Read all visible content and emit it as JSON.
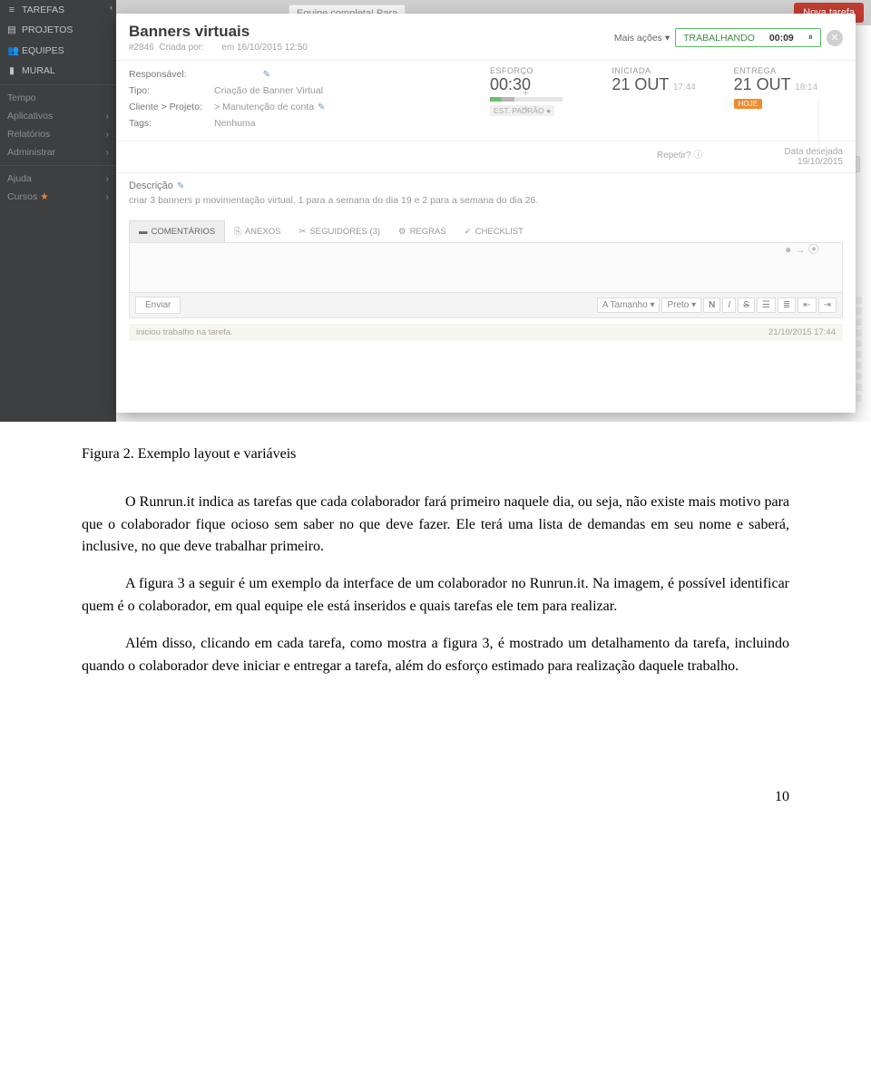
{
  "sidebar": {
    "items": [
      "TAREFAS",
      "PROJETOS",
      "EQUIPES",
      "MURAL"
    ],
    "sub": [
      "Tempo",
      "Aplicativos",
      "Relatórios",
      "Administrar"
    ],
    "help": "Ajuda",
    "courses": "Cursos"
  },
  "bg": {
    "equip": "Equipe completa! Para",
    "newtask": "Nova tarefa"
  },
  "modal": {
    "title": "Banners virtuais",
    "meta_id": "#2846",
    "meta_created_label": "Criada por:",
    "meta_date": "em 16/10/2015 12:50",
    "more": "Mais ações ▾",
    "status_label": "TRABALHANDO",
    "status_time": "00:09",
    "pause": "⏸",
    "fields": {
      "resp_label": "Responsável:",
      "tipo_label": "Tipo:",
      "tipo_val": "Criação de Banner Virtual",
      "cp_label": "Cliente > Projeto:",
      "cp_val": "> Manutenção de conta",
      "tags_label": "Tags:",
      "tags_val": "Nenhuma"
    },
    "cards": {
      "effort_label": "ESFORÇO",
      "effort_val": "00:30",
      "est_label": "EST. PADRÃO",
      "start_label": "INICIADA",
      "start_date": "21 OUT",
      "start_time": "17:44",
      "due_label": "ENTREGA",
      "due_date": "21 OUT",
      "due_time": "18:14",
      "hoje": "HOJE"
    },
    "repeat_label": "Repetir?",
    "desired_label": "Data desejada",
    "desired_val": "19/10/2015",
    "desc_title": "Descrição",
    "desc_text": "criar 3 banners p movimentação virtual. 1 para a semana do dia 19 e 2 para a semana do dia 26.",
    "tabs": [
      "COMENTÁRIOS",
      "ANEXOS",
      "SEGUIDORES (3)",
      "REGRAS",
      "CHECKLIST"
    ],
    "send": "Enviar",
    "tool_size": "A Tamanho ▾",
    "tool_color": "Preto ▾",
    "log_text": "iniciou trabalho na tarefa.",
    "log_date": "21/10/2015 17:44"
  },
  "doc": {
    "caption": "Figura 2. Exemplo layout e variáveis",
    "p1": "O Runrun.it indica as tarefas que cada colaborador fará primeiro naquele dia, ou seja, não existe mais motivo para que o colaborador fique ocioso sem saber no que deve fazer. Ele terá uma lista de demandas em seu nome e saberá, inclusive, no que deve trabalhar primeiro.",
    "p2": "A figura 3 a seguir é um exemplo da interface de um colaborador no Runrun.it. Na imagem, é possível identificar quem é o colaborador, em qual equipe ele está inseridos e quais tarefas ele tem para realizar.",
    "p3": "Além disso, clicando em cada tarefa, como mostra a figura 3, é mostrado um detalhamento da tarefa, incluindo quando o colaborador deve iniciar e entregar a tarefa, além do esforço estimado para realização daquele trabalho.",
    "pagenum": "10"
  }
}
